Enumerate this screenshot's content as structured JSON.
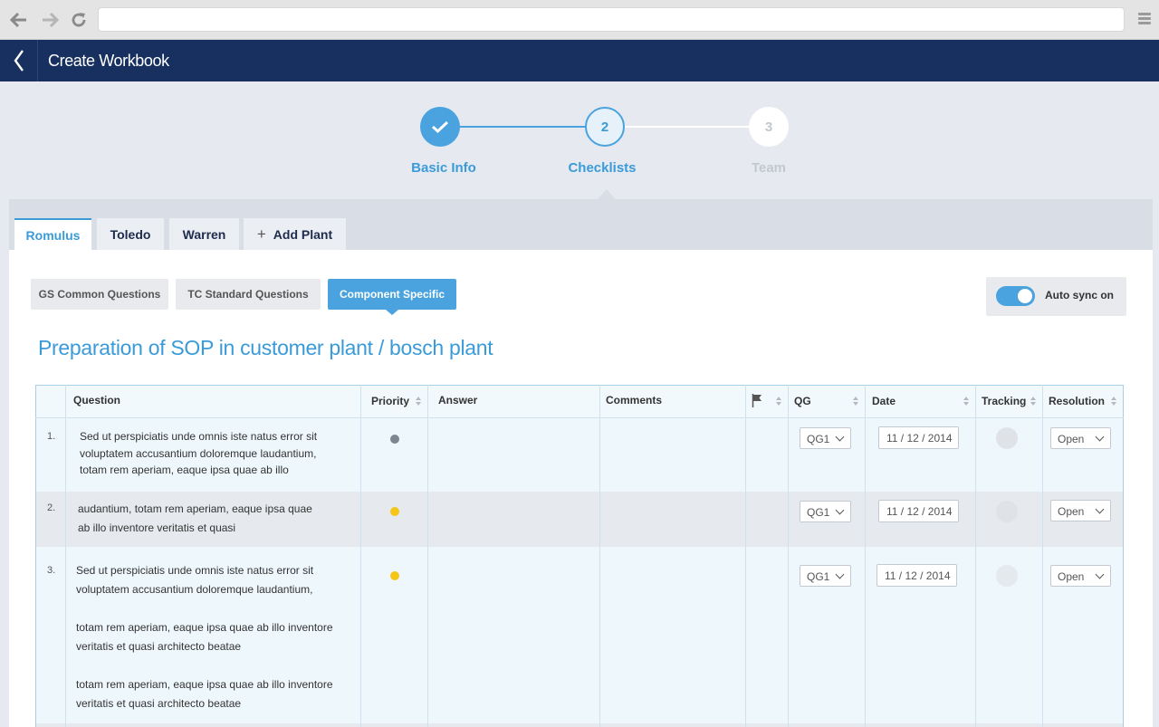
{
  "app": {
    "title": "Create Workbook"
  },
  "steps": [
    {
      "number": "",
      "label": "Basic Info",
      "state": "done"
    },
    {
      "number": "2",
      "label": "Checklists",
      "state": "current"
    },
    {
      "number": "3",
      "label": "Team",
      "state": "upcoming"
    }
  ],
  "tabs": [
    {
      "label": "Romulus",
      "active": true
    },
    {
      "label": "Toledo"
    },
    {
      "label": "Warren"
    },
    {
      "label": "Add Plant"
    }
  ],
  "segments": [
    {
      "label": "GS Common Questions"
    },
    {
      "label": "TC Standard Questions"
    },
    {
      "label": "Component Specific",
      "active": true
    }
  ],
  "autosync": {
    "label": "Auto sync on",
    "on": true
  },
  "section": {
    "title": "Preparation of SOP in customer plant / bosch plant"
  },
  "table": {
    "headers": {
      "question": "Question",
      "priority": "Priority",
      "answer": "Answer",
      "comments": "Comments",
      "qg": "QG",
      "date": "Date",
      "tracking": "Tracking",
      "resolution": "Resolution"
    },
    "rows": [
      {
        "num": "1.",
        "lines": [
          "Sed ut perspiciatis unde omnis iste natus error sit",
          "voluptatem accusantium doloremque laudantium,",
          "totam rem aperiam, eaque ipsa quae ab illo"
        ],
        "priority_color": "#7d8590",
        "qg": "QG1",
        "date": "11 / 12 / 2014",
        "resolution": "Open"
      },
      {
        "num": "2.",
        "lines": [
          "audantium, totam rem aperiam, eaque ipsa quae",
          "ab illo inventore veritatis et quasi"
        ],
        "priority_color": "#f5c518",
        "qg": "QG1",
        "date": "11 / 12 / 2014",
        "resolution": "Open"
      },
      {
        "num": "3.",
        "lines": [
          "Sed ut perspiciatis unde omnis iste natus error sit",
          "voluptatem accusantium doloremque laudantium,",
          "",
          "totam rem aperiam, eaque ipsa quae ab illo inventore",
          "veritatis et quasi architecto beatae",
          "",
          "totam rem aperiam, eaque ipsa quae ab illo inventore",
          "veritatis et quasi architecto beatae"
        ],
        "priority_color": "#f5c518",
        "qg": "QG1",
        "date": "11 / 12 / 2014",
        "resolution": "Open"
      }
    ]
  }
}
